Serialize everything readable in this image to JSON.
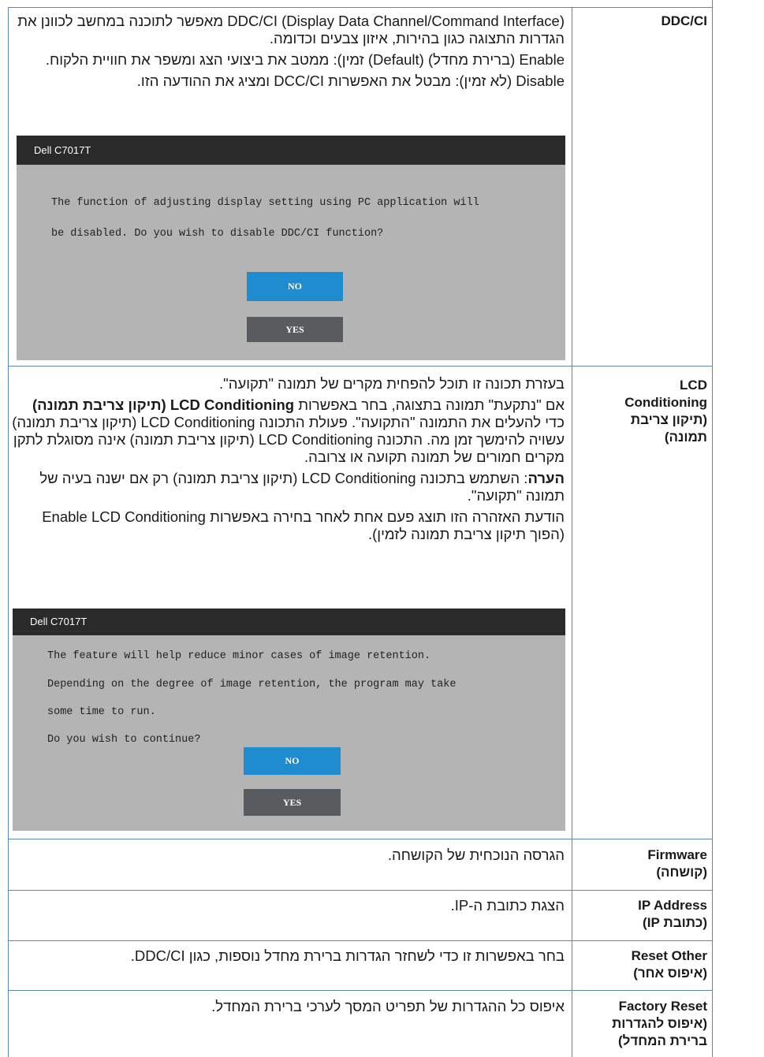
{
  "rows": [
    {
      "label": [
        "DDC/CI"
      ],
      "paras": [
        "DDC/CI (Display Data Channel/Command Interface) מאפשר לתוכנה במחשב לכוונן את הגדרות התצוגה כגון בהירות, איזון צבעים וכדומה.",
        "Enable (ברירת מחדל) (Default) זמין): ממטב את ביצועי הצג ומשפר את חוויית הלקוח.",
        "Disable (לא זמין): מבטל את האפשרות DCC/CI ומציג את ההודעה הזו."
      ],
      "dialog": {
        "title": "Dell C7017T",
        "lines": [
          "The function of adjusting display setting using PC application will",
          "be disabled. Do you wish to disable DDC/CI function?"
        ],
        "no": "NO",
        "yes": "YES"
      }
    },
    {
      "label": [
        "LCD",
        "Conditioning",
        "(תיקון צריבת",
        "תמונה)"
      ],
      "p1": "בעזרת תכונה זו תוכל להפחית מקרים של תמונה \"תקועה\".",
      "p2_pre": "אם \"נתקעת\" תמונה בתצוגה, בחר באפשרות ",
      "p2_bold": "LCD Conditioning (תיקון צריבת תמונה)",
      "p2_post": " כדי להעלים את התמונה \"התקועה\". פעולת התכונה LCD Conditioning (תיקון צריבת תמונה) עשויה להימשך זמן מה. התכונה LCD Conditioning (תיקון צריבת תמונה) אינה מסוגלת לתקן מקרים חמורים של תמונה תקועה או צרובה.",
      "p3_bold": "הערה",
      "p3_post": ": השתמש בתכונה LCD Conditioning (תיקון צריבת תמונה) רק אם ישנה בעיה של תמונה \"תקועה\".",
      "p4": "הודעת האזהרה הזו תוצג פעם אחת לאחר בחירה באפשרות Enable LCD Conditioning (הפוך תיקון צריבת תמונה לזמין).",
      "dialog": {
        "title": "Dell C7017T",
        "lines": [
          "The feature will help reduce minor cases of image retention.",
          "Depending on the degree of image retention, the program may take",
          "some time to run.",
          "Do you wish to continue?"
        ],
        "no": "NO",
        "yes": "YES"
      }
    },
    {
      "label": [
        "Firmware",
        "(קושחה)"
      ],
      "desc": "הגרסה הנוכחית של הקושחה."
    },
    {
      "label": [
        "IP Address",
        "(כתובת IP)"
      ],
      "desc": "הצגת כתובת ה-IP."
    },
    {
      "label": [
        "Reset Other",
        "(איפוס אחר)"
      ],
      "desc": "בחר באפשרות זו כדי לשחזר הגדרות ברירת מחדל נוספות, כגון DDC/CI."
    },
    {
      "label": [
        "Factory Reset",
        "(איפוס להגדרות",
        "ברירת המחדל)"
      ],
      "desc": "איפוס כל ההגדרות של תפריט המסך לערכי ברירת המחדל."
    }
  ]
}
